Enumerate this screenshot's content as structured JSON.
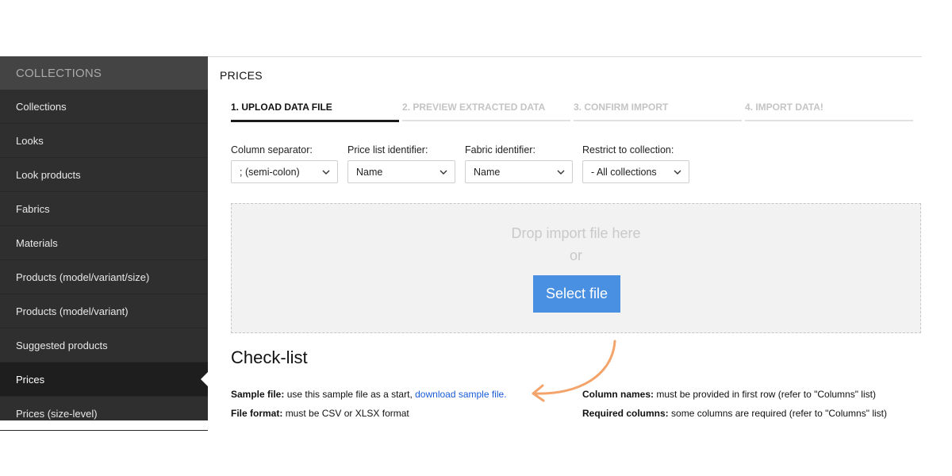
{
  "sidebar": {
    "header": "COLLECTIONS",
    "items": [
      {
        "label": "Collections"
      },
      {
        "label": "Looks"
      },
      {
        "label": "Look products"
      },
      {
        "label": "Fabrics"
      },
      {
        "label": "Materials"
      },
      {
        "label": "Products (model/variant/size)"
      },
      {
        "label": "Products (model/variant)"
      },
      {
        "label": "Suggested products"
      },
      {
        "label": "Prices",
        "active": true
      },
      {
        "label": "Prices (size-level)"
      }
    ]
  },
  "main": {
    "title": "PRICES",
    "steps": [
      {
        "label": "1. UPLOAD DATA FILE",
        "active": true
      },
      {
        "label": "2. PREVIEW EXTRACTED DATA"
      },
      {
        "label": "3. CONFIRM IMPORT"
      },
      {
        "label": "4. IMPORT DATA!"
      }
    ],
    "filters": [
      {
        "label": "Column separator:",
        "value": "; (semi-colon)"
      },
      {
        "label": "Price list identifier:",
        "value": "Name"
      },
      {
        "label": "Fabric identifier:",
        "value": "Name"
      },
      {
        "label": "Restrict to collection:",
        "value": "- All collections"
      }
    ],
    "dropzone": {
      "text": "Drop import file here",
      "or": "or",
      "button": "Select file"
    },
    "checklist": {
      "title": "Check-list",
      "sample_label": "Sample file:",
      "sample_text": "use this sample file as a start,",
      "sample_link": "download sample file.",
      "format_label": "File format:",
      "format_text": "must be CSV or XLSX format",
      "columns_label": "Column names:",
      "columns_text": "must be provided in first row (refer to \"Columns\" list)",
      "required_label": "Required columns:",
      "required_text": "some columns are required (refer to \"Columns\" list)"
    }
  },
  "colors": {
    "accent_button": "#4a90e2",
    "link": "#1a5bd8",
    "annotation_arrow": "#f4a46b"
  }
}
